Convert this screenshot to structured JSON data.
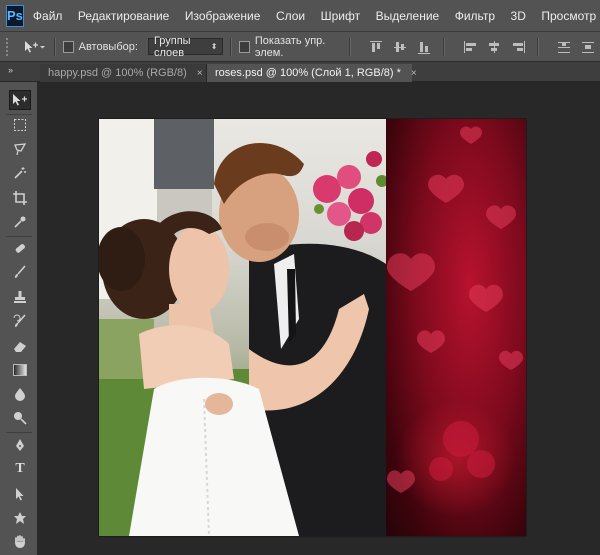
{
  "app": {
    "logo": "Ps"
  },
  "menu": [
    "Файл",
    "Редактирование",
    "Изображение",
    "Слои",
    "Шрифт",
    "Выделение",
    "Фильтр",
    "3D",
    "Просмотр"
  ],
  "options": {
    "auto_select_label": "Автовыбор:",
    "auto_select_value": "Группы слоев",
    "show_transform_label": "Показать упр. элем."
  },
  "tabs": [
    {
      "label": "happy.psd @ 100% (RGB/8)",
      "active": false
    },
    {
      "label": "roses.psd @ 100% (Слой 1, RGB/8) *",
      "active": true
    }
  ],
  "tabs_close_glyph": "×",
  "panel_collapse_glyph": "»",
  "tools": [
    "move-tool-icon",
    "marquee-tool-icon",
    "lasso-tool-icon",
    "magic-wand-tool-icon",
    "crop-tool-icon",
    "eyedropper-tool-icon",
    "healing-brush-tool-icon",
    "brush-tool-icon",
    "clone-stamp-tool-icon",
    "history-brush-tool-icon",
    "eraser-tool-icon",
    "gradient-tool-icon",
    "blur-tool-icon",
    "dodge-tool-icon",
    "pen-tool-icon",
    "type-tool-icon",
    "path-selection-tool-icon",
    "custom-shape-tool-icon",
    "hand-tool-icon"
  ],
  "type_tool_glyph": "T",
  "colors": {
    "ui_panel": "#535353",
    "ui_dark": "#282828",
    "accent_logo": "#3d8fd1",
    "rose_red": "#b8122e"
  }
}
